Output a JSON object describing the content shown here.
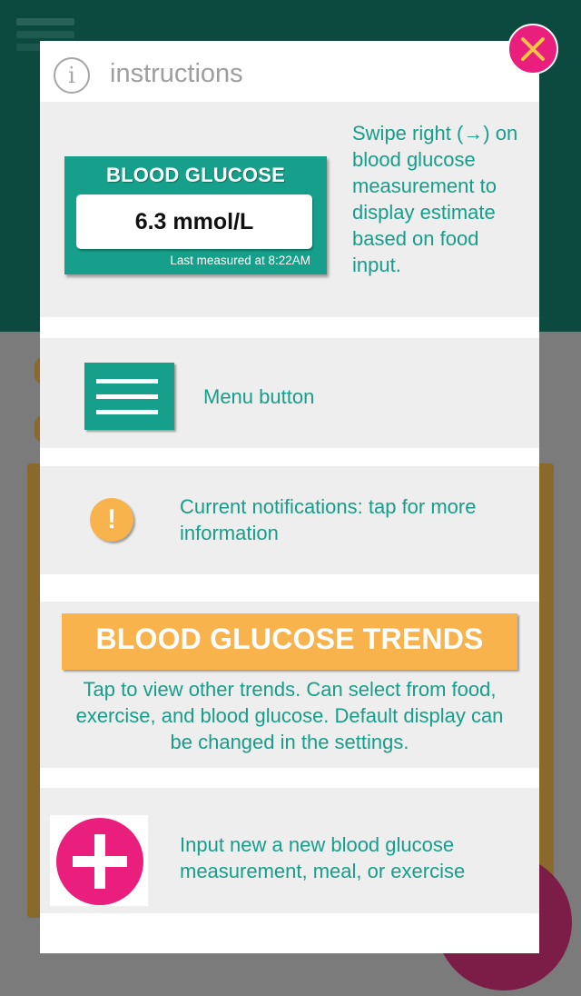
{
  "modal": {
    "title": "instructions",
    "info_icon": "info-icon",
    "close_icon": "close-icon"
  },
  "sections": {
    "glucose_card": {
      "title": "BLOOD GLUCOSE",
      "value": "6.3 mmol/L",
      "last_measured": "Last measured at 8:22AM",
      "description": "Swipe right (→) on blood glucose measurement to display estimate based on food input."
    },
    "menu": {
      "icon": "menu-icon",
      "description": "Menu button"
    },
    "notifications": {
      "icon_glyph": "!",
      "description": "Current notifications: tap for more information"
    },
    "trends": {
      "button_label": "BLOOD GLUCOSE TRENDS",
      "description": "Tap to view other trends. Can select from food, exercise, and blood glucose. Default display can be changed in the settings."
    },
    "add": {
      "icon": "plus-icon",
      "description": "Input new a new blood glucose measurement, meal, or exercise"
    }
  },
  "colors": {
    "teal": "#16a08b",
    "orange": "#f8b34c",
    "pink": "#e91e7d",
    "dark_header": "#0c4a40"
  }
}
